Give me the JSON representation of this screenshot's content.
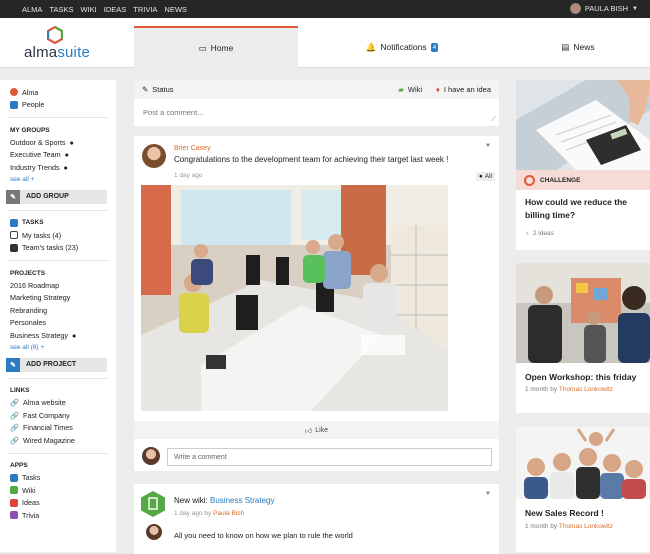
{
  "topbar": {
    "nav": [
      "ALMA",
      "TASKS",
      "WIKI",
      "IDEAS",
      "TRIVIA",
      "NEWS"
    ],
    "user": "PAULA BISH"
  },
  "logo": {
    "alma": "alma",
    "suite": "suite"
  },
  "tabs": {
    "home": "Home",
    "notifications": "Notifications",
    "notif_count": "4",
    "news": "News"
  },
  "sidebar": {
    "top": [
      "Alma",
      "People"
    ],
    "groups_head": "MY GROUPS",
    "groups": [
      "Outdoor & Sports",
      "Executive Team",
      "Industry Trends"
    ],
    "groups_seeall": "see all +",
    "add_group": "ADD GROUP",
    "tasks_head": "TASKS",
    "tasks": [
      "My tasks (4)",
      "Team's tasks (23)"
    ],
    "projects_head": "PROJECTS",
    "projects": [
      "2016 Roadmap",
      "Marketing Strategy",
      "Rebranding",
      "Personales",
      "Business Strategy"
    ],
    "projects_seeall": "see all (6) +",
    "add_project": "ADD PROJECT",
    "links_head": "LINKS",
    "links": [
      "Alma website",
      "Fast Company",
      "Financial Times",
      "Wired Magazine"
    ],
    "apps_head": "APPS",
    "apps": [
      "Tasks",
      "Wiki",
      "Ideas",
      "Trivia"
    ]
  },
  "status": {
    "status_label": "Status",
    "wiki_label": "Wiki",
    "idea_label": "I have an idea",
    "placeholder": "Post a comment..."
  },
  "post1": {
    "author": "Brier Casey",
    "text": "Congratulations to the development team for achieving their target last week !",
    "time": "1 day ago",
    "visibility": "All",
    "like": "Like",
    "comment_placeholder": "Write a comment"
  },
  "post2": {
    "prefix": "New wiki: ",
    "link": "Business Strategy",
    "time": "1 day ago by ",
    "by": "Paula Bish",
    "comment": "All you need to know on how we plan to rule the world"
  },
  "right": {
    "challenge_label": "CHALLENGE",
    "challenge_title": "How could we reduce the billing time?",
    "ideas": "2 ideas",
    "news1_title": "Open Workshop: this friday",
    "news1_meta": "1 month by ",
    "news1_author": "Thomas Lonkowitz",
    "news2_title": "New Sales Record !",
    "news2_meta": "1 month by ",
    "news2_author": "Thomas Lonkowitz"
  },
  "colors": {
    "accent": "#e05a3a",
    "blue": "#2b7ac2",
    "green": "#55a844",
    "orange": "#e06b2a"
  }
}
